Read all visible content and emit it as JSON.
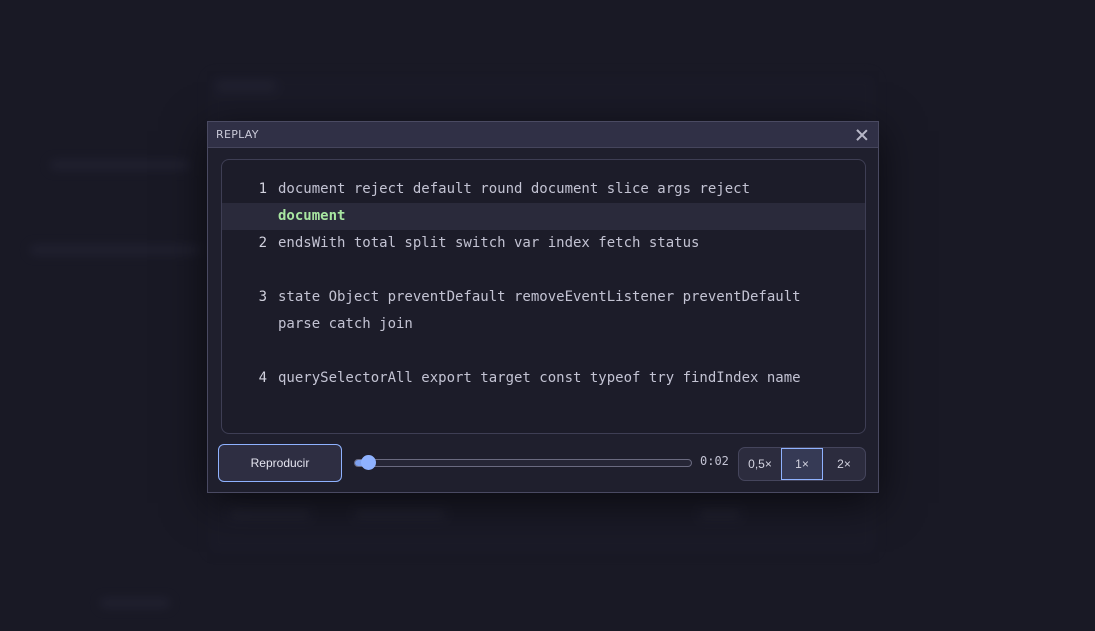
{
  "dialog": {
    "title": "REPLAY",
    "close_label": "×"
  },
  "code_lines": [
    {
      "number": "1",
      "text": "document reject default round document slice args reject"
    },
    {
      "number": "",
      "text": "document",
      "active": true
    },
    {
      "number": "2",
      "text": "endsWith total split switch var index fetch status"
    },
    {
      "number": "3",
      "text": "state Object preventDefault removeEventListener preventDefault"
    },
    {
      "number": "",
      "text": "parse catch join"
    },
    {
      "number": "4",
      "text": "querySelectorAll export target const typeof try findIndex name"
    }
  ],
  "controls": {
    "play_label": "Reproducir",
    "progress": 0.04,
    "time": "0:02",
    "speeds": [
      "0,5×",
      "1×",
      "2×"
    ],
    "selected_speed": "1×"
  },
  "colors": {
    "accent": "#8fb2ff",
    "active_code": "#a8e6a1"
  }
}
